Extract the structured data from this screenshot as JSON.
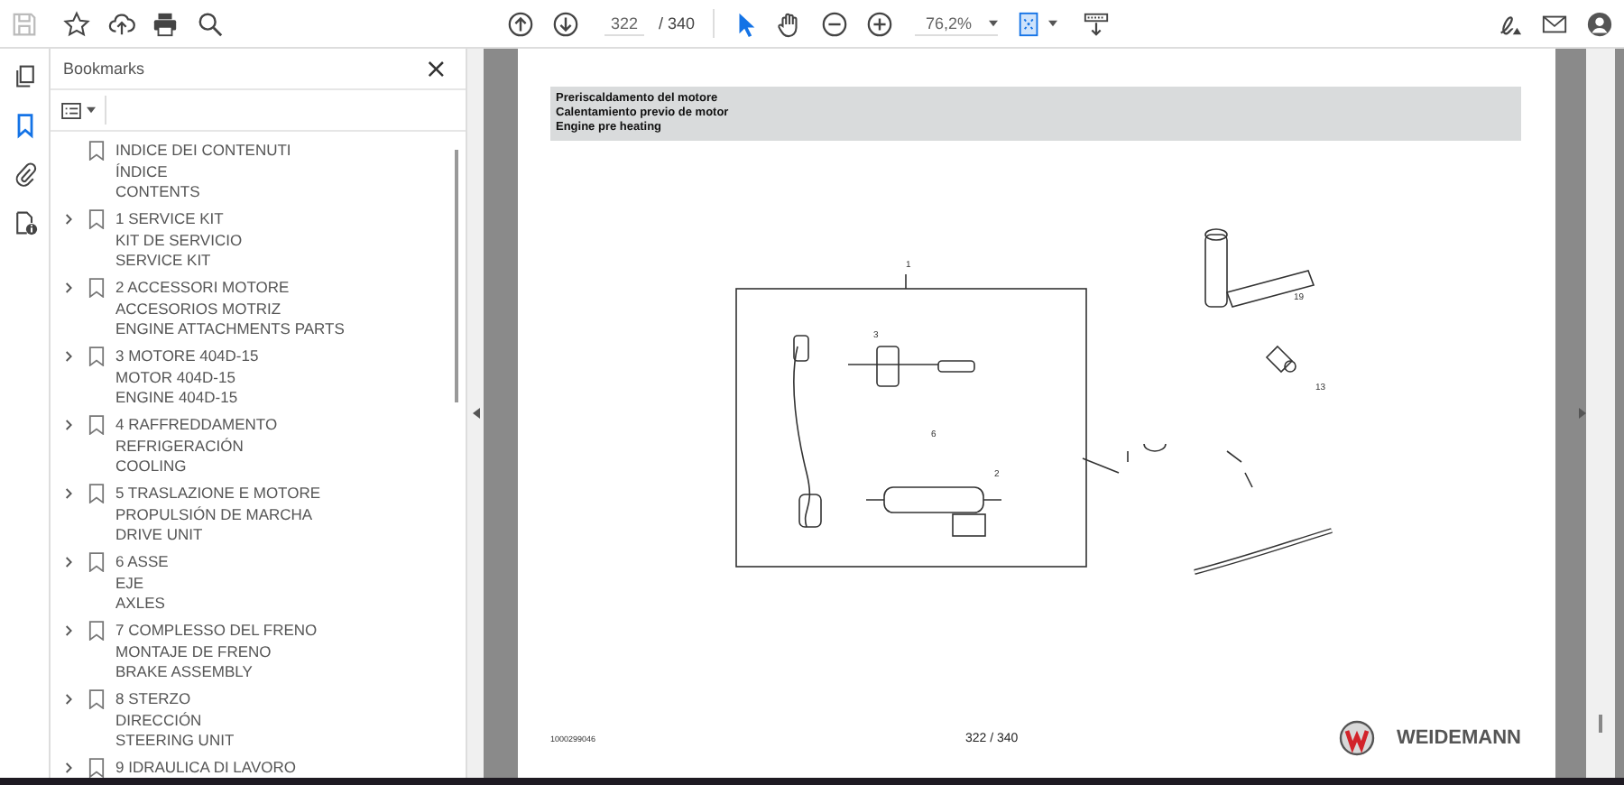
{
  "toolbar": {
    "page_current": "322",
    "page_total": "/ 340",
    "zoom": "76,2%"
  },
  "sidebar": {
    "title": "Bookmarks",
    "close": "×",
    "items": [
      {
        "lines": [
          "INDICE DEI CONTENUTI",
          "ÍNDICE",
          "CONTENTS"
        ],
        "expandable": false
      },
      {
        "lines": [
          "1 SERVICE KIT",
          "KIT DE SERVICIO",
          "SERVICE KIT"
        ],
        "expandable": true
      },
      {
        "lines": [
          "2 ACCESSORI MOTORE",
          "ACCESORIOS MOTRIZ",
          "ENGINE ATTACHMENTS PARTS"
        ],
        "expandable": true
      },
      {
        "lines": [
          "3 MOTORE 404D-15",
          "MOTOR 404D-15",
          "ENGINE 404D-15"
        ],
        "expandable": true
      },
      {
        "lines": [
          "4 RAFFREDDAMENTO",
          "REFRIGERACIÓN",
          "COOLING"
        ],
        "expandable": true
      },
      {
        "lines": [
          "5 TRASLAZIONE E MOTORE",
          "PROPULSIÓN DE MARCHA",
          "DRIVE UNIT"
        ],
        "expandable": true
      },
      {
        "lines": [
          "6 ASSE",
          "EJE",
          "AXLES"
        ],
        "expandable": true
      },
      {
        "lines": [
          "7 COMPLESSO DEL FRENO",
          "MONTAJE DE FRENO",
          "BRAKE ASSEMBLY"
        ],
        "expandable": true
      },
      {
        "lines": [
          "8 STERZO",
          "DIRECCIÓN",
          "STEERING UNIT"
        ],
        "expandable": true
      },
      {
        "lines": [
          "9 IDRAULICA DI LAVORO"
        ],
        "expandable": true
      }
    ]
  },
  "page": {
    "header_lines": [
      "Preriscaldamento del motore",
      "Calentamiento previo de motor",
      "Engine pre heating"
    ],
    "callouts": [
      "1",
      "2",
      "3",
      "6",
      "19",
      "13"
    ],
    "doc_number": "1000299046",
    "page_number": "322 / 340",
    "brand": "WEIDEMANN"
  }
}
